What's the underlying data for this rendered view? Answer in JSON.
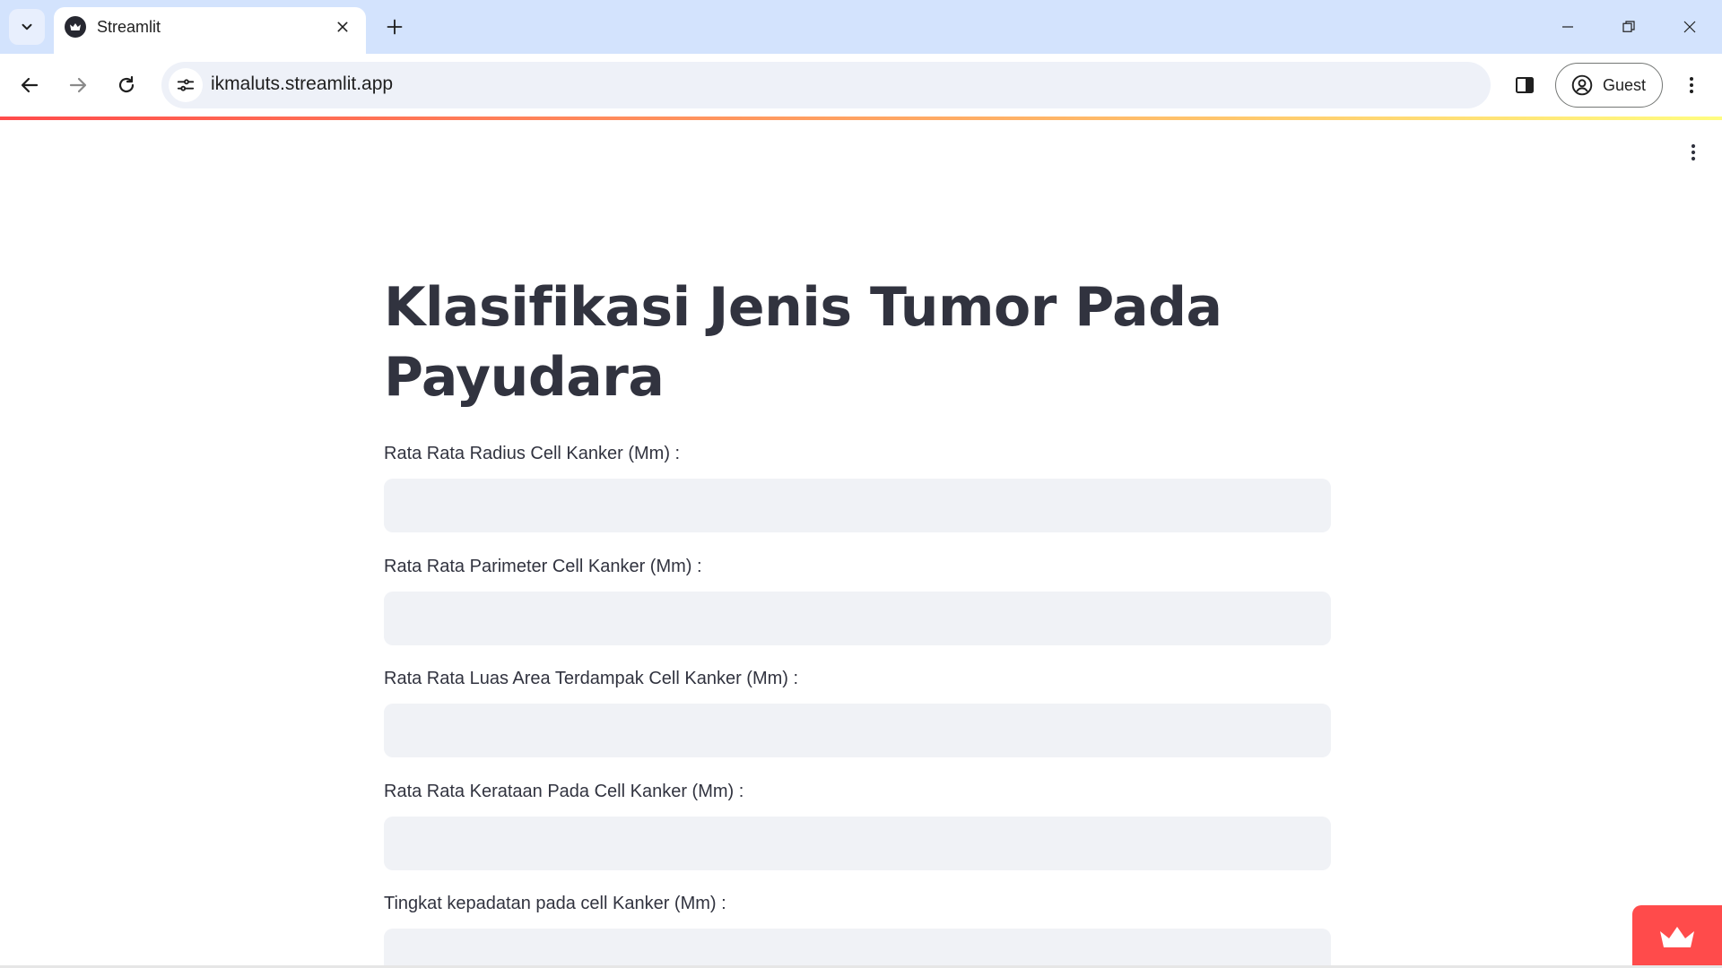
{
  "browser": {
    "tab_title": "Streamlit",
    "url": "ikmaluts.streamlit.app",
    "profile_label": "Guest"
  },
  "app": {
    "title": "Klasifikasi Jenis Tumor Pada Payudara",
    "fields": [
      {
        "label": "Rata Rata Radius Cell Kanker (Mm) :",
        "value": ""
      },
      {
        "label": "Rata Rata Parimeter Cell Kanker (Mm) :",
        "value": ""
      },
      {
        "label": "Rata Rata Luas Area Terdampak Cell Kanker (Mm) :",
        "value": ""
      },
      {
        "label": "Rata Rata Kerataan Pada Cell Kanker (Mm) :",
        "value": ""
      },
      {
        "label": "Tingkat kepadatan pada cell Kanker (Mm) :",
        "value": ""
      }
    ]
  },
  "colors": {
    "streamlit_red": "#ff4b4b",
    "text": "#31333f",
    "input_bg": "#f0f2f6",
    "chrome_tabbar": "#d3e3fd"
  },
  "icons": {
    "tab_search": "chevron-down-icon",
    "favicon": "streamlit-crown-icon",
    "tab_close": "close-icon",
    "new_tab": "plus-icon",
    "back": "arrow-left-icon",
    "forward": "arrow-right-icon",
    "reload": "reload-icon",
    "site_info": "tune-icon",
    "side_panel": "side-panel-icon",
    "profile": "account-circle-icon",
    "menu": "kebab-menu-icon",
    "badge": "streamlit-crown-icon"
  }
}
